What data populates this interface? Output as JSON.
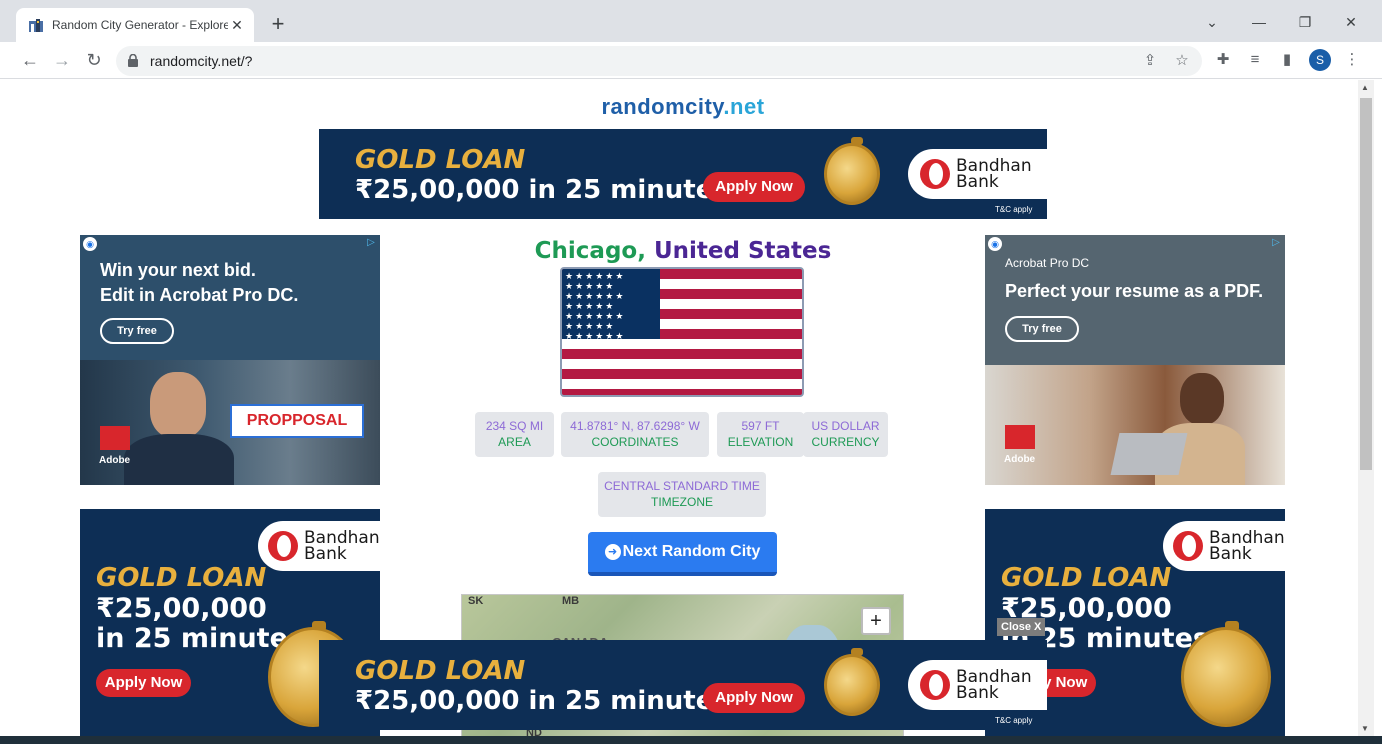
{
  "browser": {
    "tab_title": "Random City Generator - Explore",
    "url": "randomcity.net/?",
    "profile_initial": "S"
  },
  "site": {
    "logo_part1": "randomcity",
    "logo_part2": ".net"
  },
  "ads": {
    "gold_loan": {
      "title": "GOLD LOAN",
      "amount_line": "₹25,00,000 in 25 minutes",
      "amount_short": "₹25,00,000",
      "minutes": "in 25 minutes",
      "apply_label": "Apply Now",
      "bank_line1": "Bandhan",
      "bank_line2": "Bank",
      "tc": "T&C apply"
    },
    "adobe_left": {
      "line1": "Win your next bid.",
      "line2": "Edit in Acrobat Pro DC.",
      "cta": "Try free",
      "badge_text": "PROPPOSAL",
      "brand": "Adobe"
    },
    "adobe_right": {
      "product": "Acrobat Pro DC",
      "headline": "Perfect your resume as a PDF.",
      "cta": "Try free",
      "brand": "Adobe"
    },
    "close_label": "Close X"
  },
  "city": {
    "name": "Chicago,",
    "country": "United States",
    "stats": [
      {
        "value": "234 SQ MI",
        "label": "AREA"
      },
      {
        "value": "41.8781° N, 87.6298° W",
        "label": "COORDINATES"
      },
      {
        "value": "597 FT",
        "label": "ELEVATION"
      },
      {
        "value": "US DOLLAR",
        "label": "CURRENCY"
      },
      {
        "value": "CENTRAL STANDARD TIME",
        "label": "TIMEZONE"
      }
    ],
    "next_label": "Next Random City"
  },
  "map": {
    "labels": [
      "SK",
      "MB",
      "CANADA",
      "ND"
    ],
    "zoom_in": "+"
  },
  "colors": {
    "city_name": "#1e9a55",
    "country": "#4b2694",
    "next_button": "#2b7bf0",
    "gold_bg": "#0d2e55",
    "gold_text": "#e8b03e"
  }
}
